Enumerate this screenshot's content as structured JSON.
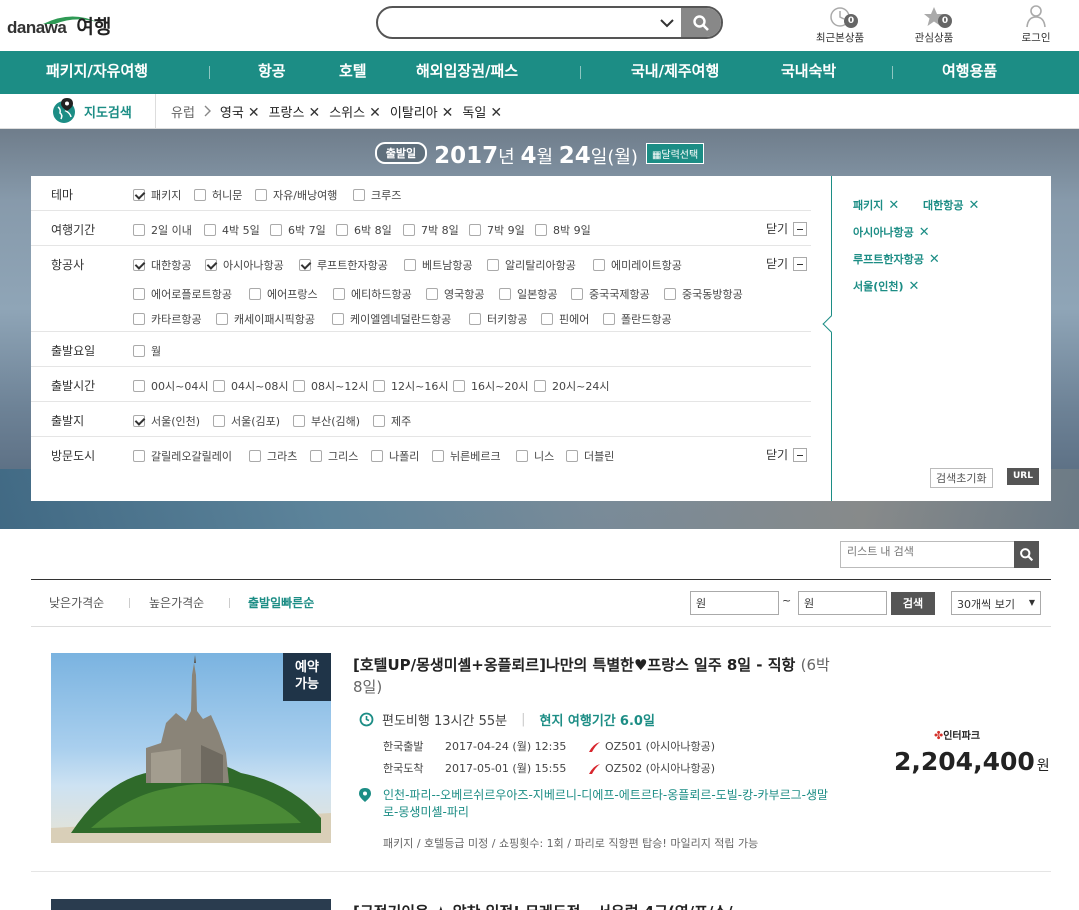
{
  "header": {
    "logo_brand": "danawa",
    "logo_section": "여행",
    "search_value": "",
    "recent": {
      "label": "최근본상품",
      "count": "0"
    },
    "favorite": {
      "label": "관심상품",
      "count": "0"
    },
    "login": {
      "label": "로그인"
    }
  },
  "gnb": [
    {
      "label": "패키지/자유여행"
    },
    {
      "label": "항공"
    },
    {
      "label": "호텔"
    },
    {
      "label": "해외입장권/패스"
    },
    {
      "label": "국내/제주여행"
    },
    {
      "label": "국내숙박"
    },
    {
      "label": "여행용품"
    }
  ],
  "breadcrumb": {
    "map_label": "지도검색",
    "root": "유럽",
    "tags": [
      "영국",
      "프랑스",
      "스위스",
      "이탈리아",
      "독일"
    ]
  },
  "date_bar": {
    "pill": "출발일",
    "year": "2017",
    "year_unit": "년",
    "month": "4",
    "month_unit": "월",
    "day": "24",
    "day_unit": "일",
    "weekday": "(월)",
    "calendar_button": "달력선택"
  },
  "filters": {
    "close_label": "닫기",
    "theme": {
      "label": "테마",
      "options": [
        {
          "text": "패키지",
          "checked": true
        },
        {
          "text": "허니문",
          "checked": false
        },
        {
          "text": "자유/배낭여행",
          "checked": false
        },
        {
          "text": "크루즈",
          "checked": false
        }
      ]
    },
    "duration": {
      "label": "여행기간",
      "options": [
        {
          "text": "2일 이내",
          "checked": false
        },
        {
          "text": "4박 5일",
          "checked": false
        },
        {
          "text": "6박 7일",
          "checked": false
        },
        {
          "text": "6박 8일",
          "checked": false
        },
        {
          "text": "7박 8일",
          "checked": false
        },
        {
          "text": "7박 9일",
          "checked": false
        },
        {
          "text": "8박 9일",
          "checked": false
        }
      ]
    },
    "airline": {
      "label": "항공사",
      "options": [
        {
          "text": "대한항공",
          "checked": true
        },
        {
          "text": "아시아나항공",
          "checked": true
        },
        {
          "text": "루프트한자항공",
          "checked": true
        },
        {
          "text": "베트남항공",
          "checked": false
        },
        {
          "text": "알리탈리아항공",
          "checked": false
        },
        {
          "text": "에미레이트항공",
          "checked": false
        },
        {
          "text": "에어로플로트항공",
          "checked": false
        },
        {
          "text": "에어프랑스",
          "checked": false
        },
        {
          "text": "에티하드항공",
          "checked": false
        },
        {
          "text": "영국항공",
          "checked": false
        },
        {
          "text": "일본항공",
          "checked": false
        },
        {
          "text": "중국국제항공",
          "checked": false
        },
        {
          "text": "중국동방항공",
          "checked": false
        },
        {
          "text": "카타르항공",
          "checked": false
        },
        {
          "text": "캐세이패시픽항공",
          "checked": false
        },
        {
          "text": "케이엘엠네덜란드항공",
          "checked": false
        },
        {
          "text": "터키항공",
          "checked": false
        },
        {
          "text": "핀에어",
          "checked": false
        },
        {
          "text": "폴란드항공",
          "checked": false
        }
      ]
    },
    "weekday": {
      "label": "출발요일",
      "options": [
        {
          "text": "월",
          "checked": false
        }
      ]
    },
    "time": {
      "label": "출발시간",
      "options": [
        {
          "text": "00시~04시",
          "checked": false
        },
        {
          "text": "04시~08시",
          "checked": false
        },
        {
          "text": "08시~12시",
          "checked": false
        },
        {
          "text": "12시~16시",
          "checked": false
        },
        {
          "text": "16시~20시",
          "checked": false
        },
        {
          "text": "20시~24시",
          "checked": false
        }
      ]
    },
    "departure": {
      "label": "출발지",
      "options": [
        {
          "text": "서울(인천)",
          "checked": true
        },
        {
          "text": "서울(김포)",
          "checked": false
        },
        {
          "text": "부산(김해)",
          "checked": false
        },
        {
          "text": "제주",
          "checked": false
        }
      ]
    },
    "city": {
      "label": "방문도시",
      "options": [
        {
          "text": "갈릴레오갈릴레이",
          "checked": false
        },
        {
          "text": "그라츠",
          "checked": false
        },
        {
          "text": "그리스",
          "checked": false
        },
        {
          "text": "나폴리",
          "checked": false
        },
        {
          "text": "뉘른베르크",
          "checked": false
        },
        {
          "text": "니스",
          "checked": false
        },
        {
          "text": "더블린",
          "checked": false
        }
      ]
    }
  },
  "selected": {
    "tags": [
      "패키지",
      "대한항공",
      "아시아나항공",
      "루프트한자항공",
      "서울(인천)"
    ],
    "reset_label": "검색초기화",
    "url_label": "URL"
  },
  "list": {
    "search_placeholder": "리스트 내 검색",
    "sort": [
      {
        "label": "낮은가격순",
        "active": false
      },
      {
        "label": "높은가격순",
        "active": false
      },
      {
        "label": "출발일빠른순",
        "active": true
      }
    ],
    "price_min_placeholder": "원",
    "price_max_placeholder": "원",
    "tilde": "~",
    "price_search": "검색",
    "per_page": "30개씩 보기"
  },
  "products": [
    {
      "badge_line1": "예약",
      "badge_line2": "가능",
      "title": "[호텔UP/몽생미셸+옹플뢰르]나만의 특별한♥프랑스 일주 8일 - 직항",
      "nights": "(6박 8일)",
      "flight_type": "편도비행",
      "flight_time": "13시간 55분",
      "local_label": "현지 여행기간",
      "local_days": "6.0일",
      "depart_label": "한국출발",
      "depart_dt": "2017-04-24 (월) 12:35",
      "depart_flight": "OZ501 (아시아나항공)",
      "arrive_label": "한국도착",
      "arrive_dt": "2017-05-01 (월) 15:55",
      "arrive_flight": "OZ502 (아시아나항공)",
      "route": "인천-파리--오베르쉬르우아즈-지베르니-디에프-에트르타-옹플뢰르-도빌-캉-카부르그-생말로-몽생미셸-파리",
      "meta": "패키지 / 호텔등급 미정 / 쇼핑횟수: 1회 / 파리로 직항편 탑승! 마일리지 적립 가능",
      "vendor": "인터파크",
      "price": "2,204,400",
      "currency": "원"
    },
    {
      "title": "[국적기이용 ★ 알찬 일정! 뮤레두정 - 서유럽 4국(영/프/스/"
    }
  ],
  "colors": {
    "brand": "#1c8d85",
    "dark": "#555555"
  }
}
